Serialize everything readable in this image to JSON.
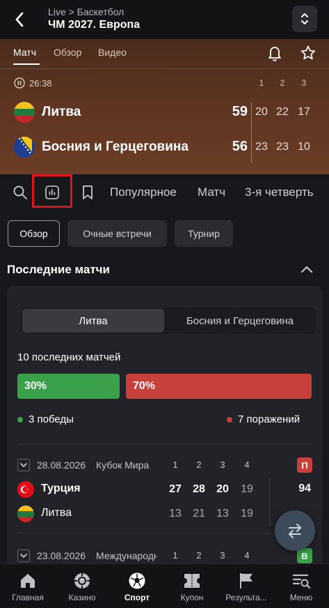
{
  "header": {
    "breadcrumb": "Live > Баскетбол",
    "title": "ЧМ 2027. Европа"
  },
  "match_tabs": [
    "Матч",
    "Обзор",
    "Видео"
  ],
  "match": {
    "time": "26:38",
    "periods": [
      "1",
      "2",
      "3"
    ],
    "teams": [
      {
        "name": "Литва",
        "score": "59",
        "periods": [
          "20",
          "22",
          "17"
        ]
      },
      {
        "name": "Босния и Герцеговина",
        "score": "56",
        "periods": [
          "23",
          "23",
          "10"
        ]
      }
    ]
  },
  "toolbar": {
    "links": [
      "Популярное",
      "Матч",
      "3-я четверть"
    ]
  },
  "chips": [
    "Обзор",
    "Очные встречи",
    "Турнир"
  ],
  "section": {
    "title": "Последние матчи"
  },
  "stats": {
    "segments": [
      "Литва",
      "Босния и Герцеговина"
    ],
    "last_n": "10 последних матчей",
    "win_pct": "30%",
    "loss_pct": "70%",
    "win_fraction": 0.3,
    "wins_label": "3 победы",
    "losses_label": "7 поражений",
    "colors": {
      "win": "#3aa14a",
      "loss": "#c8403c"
    }
  },
  "recent_matches": [
    {
      "date": "28.08.2026",
      "competition": "Кубок Мира",
      "periods": [
        "1",
        "2",
        "3",
        "4"
      ],
      "result": "П",
      "result_color": "#c8403c",
      "teams": [
        {
          "name": "Турция",
          "periods": [
            "27",
            "28",
            "20",
            "19"
          ],
          "total": "94",
          "winner": true
        },
        {
          "name": "Литва",
          "periods": [
            "13",
            "21",
            "13",
            "19"
          ],
          "total": "",
          "winner": false
        }
      ]
    },
    {
      "date": "23.08.2026",
      "competition": "Международный",
      "periods": [
        "1",
        "2",
        "3",
        "4"
      ],
      "result": "В",
      "result_color": "#3aa14a"
    }
  ],
  "bottom_nav": [
    "Главная",
    "Казино",
    "Спорт",
    "Купон",
    "Результа...",
    "Меню"
  ]
}
